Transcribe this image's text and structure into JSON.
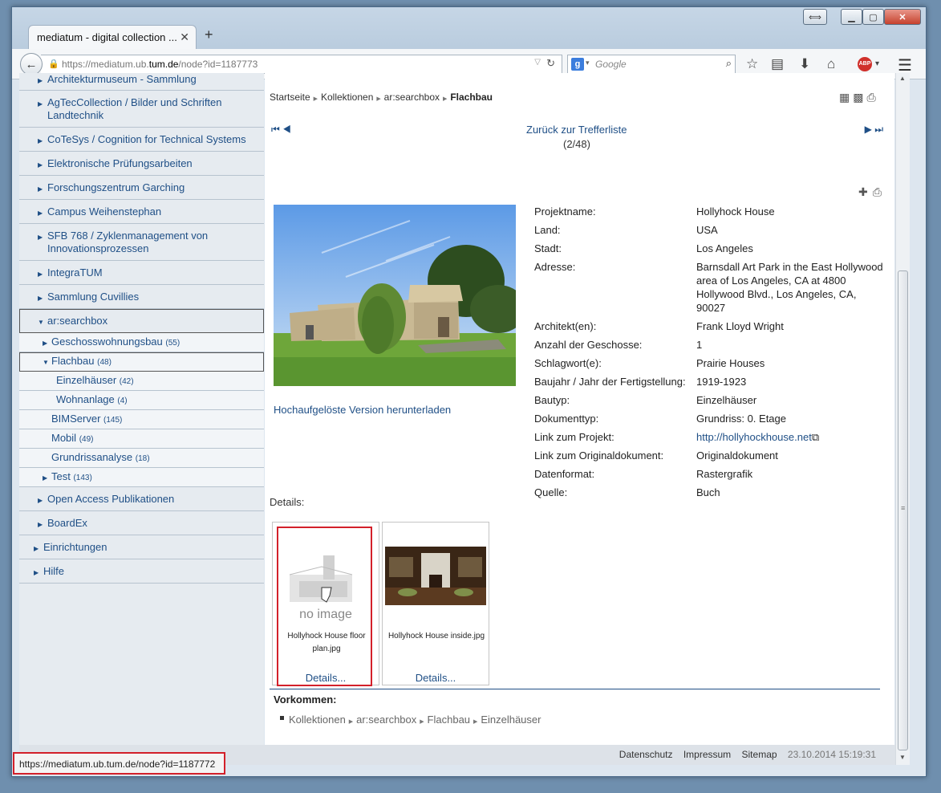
{
  "browser": {
    "tab_title": "mediatum - digital collection ...",
    "url_prefix": "https://mediatum.ub.",
    "url_host": "tum.de",
    "url_path": "/node?id=1187773",
    "search_placeholder": "Google",
    "window_buttons": {
      "restore": "⟺",
      "minimize": "▁",
      "maximize": "▢",
      "close": "✕"
    }
  },
  "sidebar": {
    "top_partial": "Architekturmuseum - Sammlung",
    "items": [
      {
        "label": "AgTecCollection / Bilder und Schriften Landtechnik"
      },
      {
        "label": "CoTeSys / Cognition for Technical Systems"
      },
      {
        "label": "Elektronische Prüfungsarbeiten"
      },
      {
        "label": "Forschungszentrum Garching"
      },
      {
        "label": "Campus Weihenstephan"
      },
      {
        "label": "SFB 768 / Zyklenmanagement von Innovationsprozessen"
      },
      {
        "label": "IntegraTUM"
      },
      {
        "label": "Sammlung Cuvillies"
      },
      {
        "label": "ar:searchbox"
      }
    ],
    "sub": {
      "geschoss": {
        "label": "Geschosswohnungsbau",
        "count": "(55)"
      },
      "flachbau": {
        "label": "Flachbau",
        "count": "(48)"
      },
      "einzel": {
        "label": "Einzelhäuser",
        "count": "(42)"
      },
      "wohn": {
        "label": "Wohnanlage",
        "count": "(4)"
      },
      "bim": {
        "label": "BIMServer",
        "count": "(145)"
      },
      "mobil": {
        "label": "Mobil",
        "count": "(49)"
      },
      "grund": {
        "label": "Grundrissanalyse",
        "count": "(18)"
      },
      "test": {
        "label": "Test",
        "count": "(143)"
      }
    },
    "after": [
      {
        "label": "Open Access Publikationen"
      },
      {
        "label": "BoardEx"
      }
    ],
    "top_level": [
      {
        "label": "Einrichtungen"
      },
      {
        "label": "Hilfe"
      }
    ]
  },
  "breadcrumb": {
    "items": [
      "Startseite",
      "Kollektionen",
      "ar:searchbox"
    ],
    "current": "Flachbau"
  },
  "pager": {
    "back": "Zurück zur Trefferliste",
    "position": "(2/48)"
  },
  "download_link": "Hochaufgelöste Version herunterladen",
  "metadata": [
    {
      "k": "Projektname:",
      "v": "Hollyhock House"
    },
    {
      "k": "Land:",
      "v": "USA"
    },
    {
      "k": "Stadt:",
      "v": "Los Angeles"
    },
    {
      "k": "Adresse:",
      "v": "Barnsdall Art Park in the East Hollywood area of Los Angeles, CA at 4800 Hollywood Blvd., Los Angeles, CA, 90027"
    },
    {
      "k": "Architekt(en):",
      "v": "Frank Lloyd Wright"
    },
    {
      "k": "Anzahl der Geschosse:",
      "v": "1"
    },
    {
      "k": "Schlagwort(e):",
      "v": "Prairie Houses"
    },
    {
      "k": "Baujahr / Jahr der Fertigstellung:",
      "v": "1919-1923"
    },
    {
      "k": "Bautyp:",
      "v": "Einzelhäuser"
    },
    {
      "k": "Dokumenttyp:",
      "v": "Grundriss: 0. Etage"
    },
    {
      "k": "Link zum Projekt:",
      "v": "http://hollyhockhouse.net"
    },
    {
      "k": "Link zum Originaldokument:",
      "v": "Originaldokument"
    },
    {
      "k": "Datenformat:",
      "v": "Rastergrafik"
    },
    {
      "k": "Quelle:",
      "v": "Buch"
    }
  ],
  "details": {
    "label": "Details:",
    "thumb1": {
      "noimage": "no image",
      "name": "Hollyhock House floor plan.jpg",
      "link": "Details..."
    },
    "thumb2": {
      "name": "Hollyhock House inside.jpg",
      "link": "Details..."
    }
  },
  "occurrence": {
    "title": "Vorkommen:",
    "path": [
      "Kollektionen",
      "ar:searchbox",
      "Flachbau",
      "Einzelhäuser"
    ]
  },
  "footer": {
    "links": [
      "Datenschutz",
      "Impressum",
      "Sitemap"
    ],
    "timestamp": "23.10.2014 15:19:31"
  },
  "statusbar": "https://mediatum.ub.tum.de/node?id=1187772",
  "colors": {
    "link": "#1f4f86",
    "highlight": "#d3202a"
  }
}
